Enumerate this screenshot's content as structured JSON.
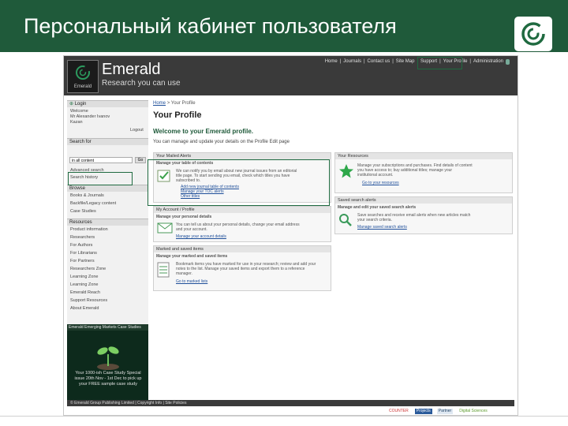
{
  "slide": {
    "title": "Персональный кабинет пользователя",
    "accent_color": "#1f5a3a"
  },
  "site": {
    "brand": "Emerald",
    "tagline": "Research you can use",
    "logo_label": "Emerald",
    "topnav": [
      "Home",
      "Journals",
      "Contact us",
      "Site Map",
      "Support",
      "Your Profile",
      "Administration"
    ]
  },
  "sidebar": {
    "login_header": "Login",
    "welcome_lines": [
      "Welcome",
      "Mr Alexander Ivanov",
      "Kazan"
    ],
    "logout": "Logout",
    "search_header": "Search for",
    "search_placeholder": "in all content",
    "go_label": "Go",
    "links_top": [
      "Advanced search",
      "Search history"
    ],
    "browse_header": "Browse",
    "browse_items": [
      "Books & Journals",
      "Backfile/Legacy content",
      "Case Studies"
    ],
    "resources_header": "Resources",
    "resources_items": [
      "Product information",
      "Researchers",
      "For Authors",
      "For Librarians",
      "For Partners",
      "Researchers Zone",
      "Learning Zone",
      "Learning Zone",
      "Emerald Reach",
      "Support Resources",
      "About Emerald"
    ],
    "ad_header": "Emerald Emerging Markets Case Studies",
    "ad_text": "Your 1000-ish Case Study Special issue 20th Nov - 1st Dec to pick up your FREE sample case study"
  },
  "main": {
    "breadcrumb_home": "Home",
    "breadcrumb_current": "> Your Profile",
    "title": "Your Profile",
    "welcome": "Welcome to your Emerald profile.",
    "intro": "You can manage and update your details on the Profile Edit page",
    "panels": {
      "mailed_alerts": {
        "header": "Your Mailed Alerts",
        "subheader": "Manage your table of contents",
        "text": [
          "We can notify you by email about new journal issues from an editorial",
          "title page. To start sending you email, check which titles you have",
          "subscribed to."
        ],
        "links": [
          "Add new journal table of contents",
          "Manage your TOC alerts",
          "Other titles"
        ]
      },
      "my_details": {
        "header": "My Account / Profile",
        "subheader": "Manage your personal details",
        "text": [
          "You can tell us about your personal details, change your email address",
          "and your account."
        ],
        "links": [
          "Manage your account details"
        ]
      },
      "marked_lists": {
        "header": "Marked and saved items",
        "subheader": "Manage your marked and saved items",
        "text": [
          "Bookmark items you have marked for use in your research; review and add your",
          "notes to the list. Manage your saved items and export them to a reference",
          "manager."
        ],
        "links": [
          "Go to marked lists"
        ]
      },
      "your_resources": {
        "header": "Your Resources",
        "text": [
          "Manage your subscriptions and purchases. Find details of content",
          "you have access to; buy additional titles; manage your",
          "institutional account."
        ],
        "links": [
          "Go to your resources"
        ]
      },
      "saved_searches": {
        "header": "Saved search alerts",
        "subheader": "Manage and edit your saved search alerts",
        "text": [
          "Save searches and receive email alerts when new articles match",
          "your search criteria."
        ],
        "links": [
          "Manage saved search alerts"
        ]
      }
    }
  },
  "footer": {
    "text": "© Emerald Group Publishing Limited   |   Copyright Info   |   Site Policies",
    "credits": [
      "COUNTER",
      "Projects",
      "Partner",
      "Digital Sciences"
    ]
  }
}
